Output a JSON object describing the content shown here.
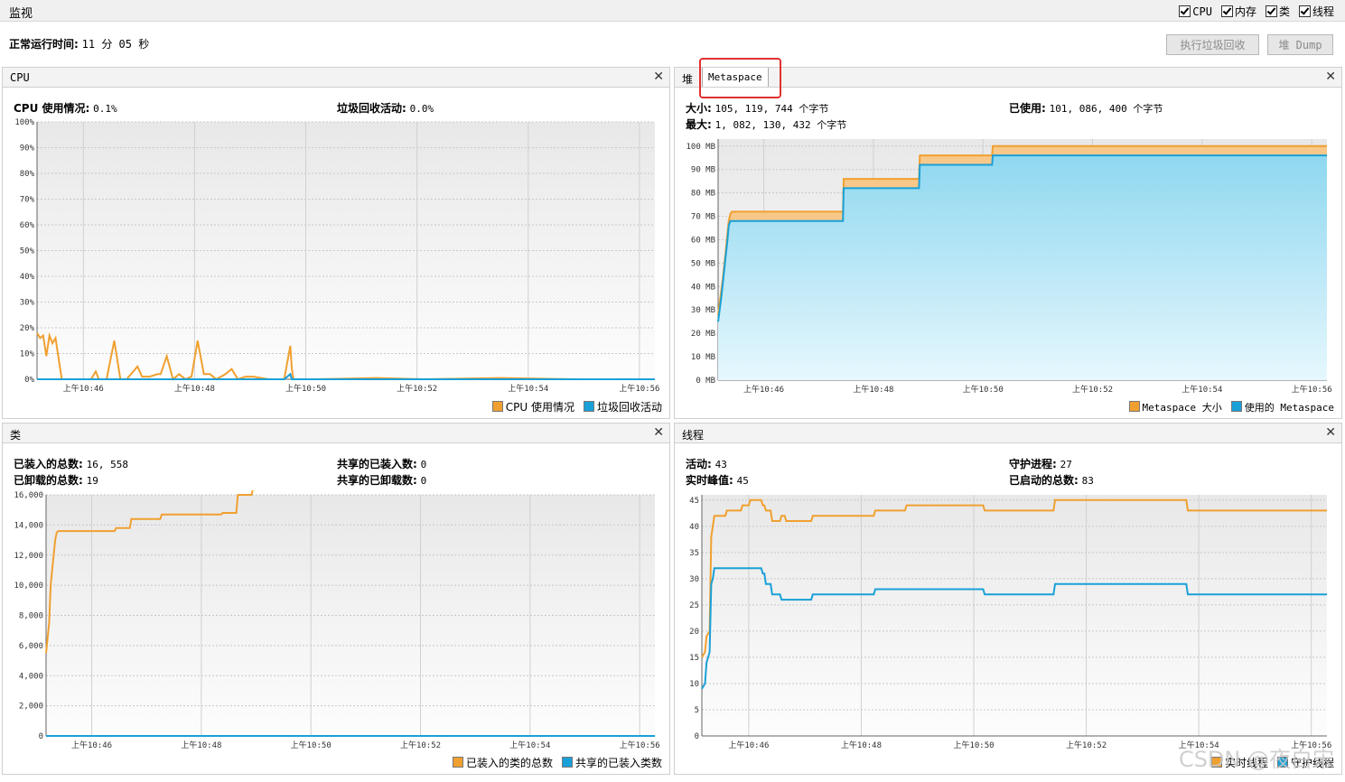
{
  "top": {
    "title": "监视",
    "checkboxes": [
      {
        "label": "CPU",
        "checked": true
      },
      {
        "label": "内存",
        "checked": true
      },
      {
        "label": "类",
        "checked": true
      },
      {
        "label": "线程",
        "checked": true
      }
    ]
  },
  "uptime": {
    "label": "正常运行时间:",
    "value": "11 分 05 秒"
  },
  "buttons": {
    "gc": "执行垃圾回收",
    "heap_dump": "堆 Dump"
  },
  "cpu": {
    "title": "CPU",
    "usage_label": "CPU 使用情况:",
    "usage_value": "0.1%",
    "gc_label": "垃圾回收活动:",
    "gc_value": "0.0%",
    "legend": [
      "CPU 使用情况",
      "垃圾回收活动"
    ]
  },
  "memory": {
    "tabs": [
      "堆",
      "Metaspace"
    ],
    "size_label": "大小:",
    "size_value": "105, 119, 744 个字节",
    "used_label": "已使用:",
    "used_value": "101, 086, 400 个字节",
    "max_label": "最大:",
    "max_value": "1, 082, 130, 432 个字节",
    "legend": [
      "Metaspace 大小",
      "使用的 Metaspace"
    ]
  },
  "classes": {
    "title": "类",
    "loaded_label": "已装入的总数:",
    "loaded_value": "16, 558",
    "unloaded_label": "已卸载的总数:",
    "unloaded_value": "19",
    "shared_loaded_label": "共享的已装入数:",
    "shared_loaded_value": "0",
    "shared_unloaded_label": "共享的已卸载数:",
    "shared_unloaded_value": "0",
    "legend": [
      "已装入的类的总数",
      "共享的已装入类数"
    ]
  },
  "threads": {
    "title": "线程",
    "live_label": "活动:",
    "live_value": "43",
    "peak_label": "实时峰值:",
    "peak_value": "45",
    "daemon_label": "守护进程:",
    "daemon_value": "27",
    "started_label": "已启动的总数:",
    "started_value": "83",
    "legend": [
      "实时线程",
      "守护线程"
    ]
  },
  "colors": {
    "orange": "#f0a030",
    "blue": "#1aa0d8",
    "red": "#e03030"
  },
  "watermark": "CSDN @夜白宋",
  "chart_data": [
    {
      "type": "line",
      "title": "CPU",
      "x": [
        "上午10:46",
        "上午10:48",
        "上午10:50",
        "上午10:52",
        "上午10:54",
        "上午10:56"
      ],
      "yticks": [
        "0%",
        "10%",
        "20%",
        "30%",
        "40%",
        "50%",
        "60%",
        "70%",
        "80%",
        "90%",
        "100%"
      ],
      "ylim": [
        0,
        100
      ],
      "t": [
        0,
        0.2,
        0.4,
        0.6,
        0.8,
        1.0,
        1.2,
        1.4,
        1.6,
        2.5,
        3.5,
        3.8,
        4.0,
        4.2,
        4.5,
        5.0,
        5.4,
        5.6,
        5.8,
        6.5,
        6.8,
        7.0,
        7.3,
        7.8,
        8.0,
        8.4,
        8.8,
        9.2,
        9.6,
        10.0,
        10.4,
        10.8,
        11.2,
        11.6,
        12.2,
        12.6,
        13.0,
        13.5,
        14.0,
        15.0,
        16.0,
        16.4,
        16.5,
        16.6,
        18.0,
        22.0,
        25.0,
        30.0,
        35.0,
        40.0
      ],
      "series": [
        {
          "name": "CPU 使用情况",
          "values": [
            18,
            16,
            17,
            9,
            17,
            14,
            16,
            8,
            0,
            0,
            0,
            3,
            0,
            0,
            0,
            15,
            0,
            0,
            0,
            5,
            1,
            1,
            1,
            2,
            2,
            9,
            0,
            2,
            0,
            1,
            15,
            2,
            2,
            0,
            2,
            4,
            0,
            1,
            1,
            0,
            0,
            13,
            4,
            0,
            0,
            0.5,
            0,
            0.5,
            0,
            0
          ]
        },
        {
          "name": "垃圾回收活动",
          "values": [
            0,
            0,
            0,
            0,
            0,
            0,
            0,
            0,
            0,
            0,
            0,
            0,
            0,
            0,
            0,
            0,
            0,
            0,
            0,
            0,
            0,
            0,
            0,
            0,
            0,
            0,
            0,
            0,
            0,
            0,
            0,
            0,
            0,
            0,
            0,
            0,
            0,
            0,
            0,
            0,
            0,
            2,
            0,
            0,
            0,
            0,
            0,
            0,
            0,
            0
          ]
        }
      ]
    },
    {
      "type": "area",
      "title": "Metaspace",
      "x": [
        "上午10:46",
        "上午10:48",
        "上午10:50",
        "上午10:52",
        "上午10:54",
        "上午10:56"
      ],
      "yticks": [
        "0 MB",
        "10 MB",
        "20 MB",
        "30 MB",
        "40 MB",
        "50 MB",
        "60 MB",
        "70 MB",
        "80 MB",
        "90 MB",
        "100 MB"
      ],
      "ylim": [
        0,
        103
      ],
      "t": [
        0,
        0.2,
        0.3,
        0.5,
        0.6,
        0.7,
        0.8,
        0.9,
        1.0,
        1.2,
        8.2,
        8.25,
        13.2,
        13.25,
        18.0,
        18.05,
        25.0,
        35.0,
        40.0
      ],
      "series": [
        {
          "name": "Metaspace 大小",
          "values": [
            28,
            38,
            43,
            55,
            62,
            68,
            71,
            72,
            72,
            72,
            72,
            86,
            86,
            96,
            96,
            100,
            100,
            100,
            100
          ]
        },
        {
          "name": "使用的 Metaspace",
          "values": [
            25,
            35,
            41,
            53,
            59,
            66,
            68,
            68,
            68,
            68,
            68,
            82,
            82,
            92,
            92,
            96,
            96,
            96,
            96
          ]
        }
      ]
    },
    {
      "type": "line",
      "title": "类",
      "x": [
        "上午10:46",
        "上午10:48",
        "上午10:50",
        "上午10:52",
        "上午10:54",
        "上午10:56"
      ],
      "yticks": [
        "0",
        "2,000",
        "4,000",
        "6,000",
        "8,000",
        "10,000",
        "12,000",
        "14,000",
        "16,000"
      ],
      "ylim": [
        0,
        16000
      ],
      "t": [
        0,
        0.1,
        0.2,
        0.3,
        0.4,
        0.5,
        0.6,
        0.7,
        0.8,
        4.5,
        4.6,
        5.5,
        5.6,
        7.5,
        7.6,
        11.5,
        11.6,
        12.5,
        12.6,
        13.5,
        13.6,
        17.5,
        17.6,
        40.0
      ],
      "series": [
        {
          "name": "已装入的类的总数",
          "values": [
            5500,
            6500,
            7500,
            10000,
            11000,
            12000,
            13000,
            13500,
            13600,
            13600,
            13800,
            13800,
            14400,
            14400,
            14700,
            14700,
            14800,
            14800,
            16000,
            16000,
            16400,
            16400,
            16558,
            16558
          ]
        },
        {
          "name": "共享的已装入类数",
          "values": [
            0,
            0,
            0,
            0,
            0,
            0,
            0,
            0,
            0,
            0,
            0,
            0,
            0,
            0,
            0,
            0,
            0,
            0,
            0,
            0,
            0,
            0,
            0,
            0
          ]
        }
      ]
    },
    {
      "type": "line",
      "title": "线程",
      "x": [
        "上午10:46",
        "上午10:48",
        "上午10:50",
        "上午10:52",
        "上午10:54",
        "上午10:56"
      ],
      "yticks": [
        "0",
        "5",
        "10",
        "15",
        "20",
        "25",
        "30",
        "35",
        "40",
        "45"
      ],
      "ylim": [
        0,
        46
      ],
      "t": [
        0,
        0.2,
        0.3,
        0.5,
        0.6,
        0.7,
        0.8,
        0.9,
        1.0,
        1.5,
        1.6,
        2.5,
        2.6,
        3.0,
        3.1,
        3.8,
        3.9,
        4.0,
        4.1,
        4.4,
        4.5,
        5.0,
        5.1,
        5.3,
        5.4,
        5.8,
        5.9,
        7.0,
        7.1,
        8.0,
        8.1,
        11.0,
        11.1,
        13.0,
        13.1,
        18.0,
        18.1,
        22.5,
        22.6,
        24.0,
        24.1,
        31.0,
        31.1,
        40.0
      ],
      "series": [
        {
          "name": "实时线程",
          "values": [
            15,
            16,
            19,
            20,
            38,
            40,
            42,
            42,
            42,
            42,
            43,
            43,
            44,
            44,
            45,
            45,
            44,
            44,
            43,
            43,
            41,
            41,
            42,
            42,
            41,
            41,
            41,
            41,
            42,
            42,
            42,
            42,
            43,
            43,
            44,
            44,
            43,
            43,
            45,
            45,
            45,
            45,
            43,
            43
          ]
        },
        {
          "name": "守护线程",
          "values": [
            9,
            10,
            14,
            16,
            29,
            30,
            32,
            32,
            32,
            32,
            32,
            32,
            32,
            32,
            32,
            32,
            31,
            31,
            29,
            29,
            27,
            27,
            26,
            26,
            26,
            26,
            26,
            26,
            27,
            27,
            27,
            27,
            28,
            28,
            28,
            28,
            27,
            27,
            29,
            29,
            29,
            29,
            27,
            27
          ]
        }
      ]
    }
  ]
}
